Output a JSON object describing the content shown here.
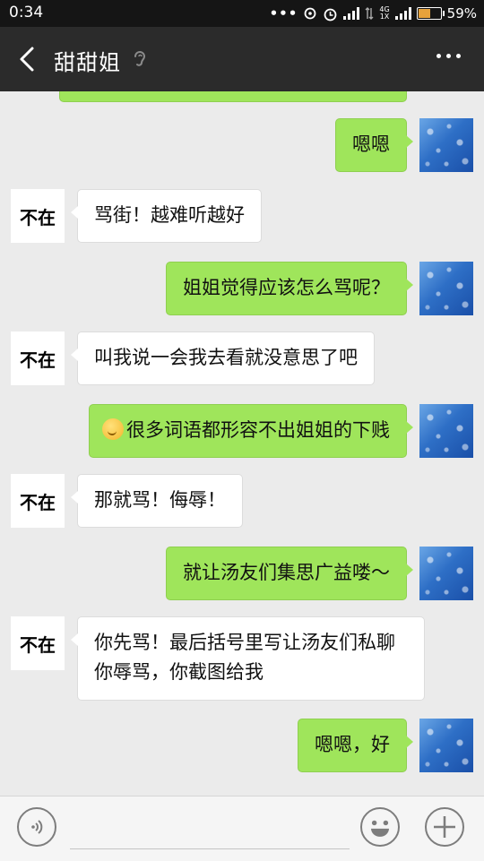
{
  "status": {
    "time": "0:34",
    "network": "4G",
    "network_sub": "1X",
    "battery": "59%",
    "battery_level": 0.59
  },
  "header": {
    "title": "甜甜姐",
    "back_icon": "back-arrow-icon",
    "ear_icon": "ear-icon",
    "more_icon": "more-dots-icon"
  },
  "contact": {
    "avatar_text": "不在"
  },
  "messages": [
    {
      "sender": "me",
      "text": "嗯嗯"
    },
    {
      "sender": "other",
      "text": "骂街！越难听越好"
    },
    {
      "sender": "me",
      "text": "姐姐觉得应该怎么骂呢？"
    },
    {
      "sender": "other",
      "text": "叫我说一会我去看就没意思了吧"
    },
    {
      "sender": "me",
      "text": "很多词语都形容不出姐姐的下贱",
      "emoji": "thinking-face"
    },
    {
      "sender": "other",
      "text": "那就骂！侮辱！"
    },
    {
      "sender": "me",
      "text": "就让汤友们集思广益喽～"
    },
    {
      "sender": "other",
      "text": "你先骂！最后括号里写让汤友们私聊你辱骂，你截图给我"
    },
    {
      "sender": "me",
      "text": "嗯嗯，好"
    }
  ],
  "input_bar": {
    "voice_icon": "voice-icon",
    "emoji_icon": "smiley-icon",
    "plus_icon": "plus-icon"
  },
  "colors": {
    "sent_bubble": "#9fe55b",
    "received_bubble": "#ffffff",
    "header_bg": "#2b2b2b",
    "chat_bg": "#ebebeb"
  }
}
